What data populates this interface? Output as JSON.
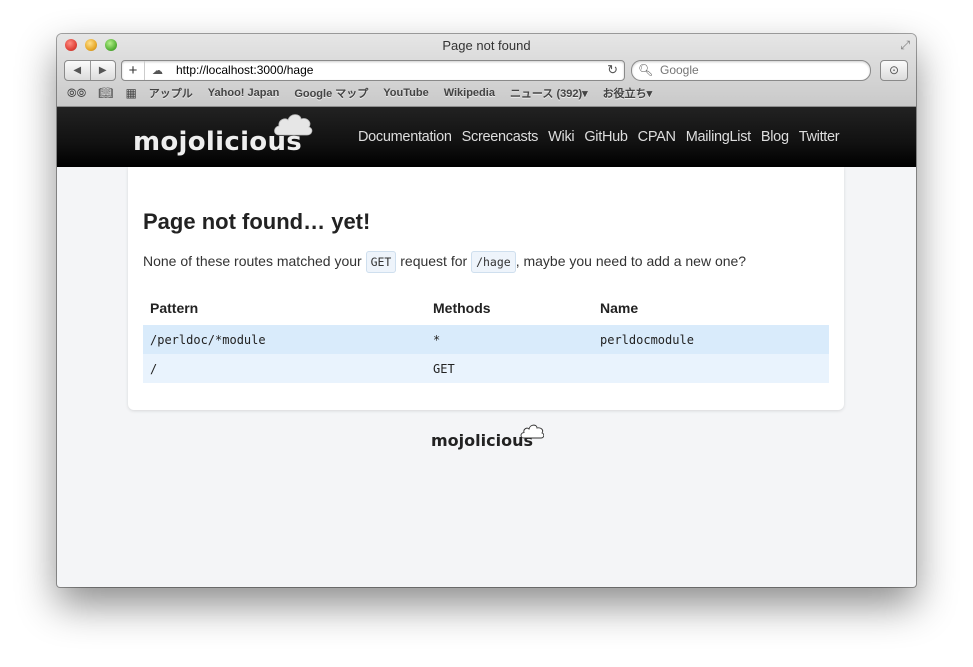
{
  "window": {
    "title": "Page not found",
    "url": "http://localhost:3000/hage",
    "search_placeholder": "Google",
    "new_tab_label": "+",
    "reload_label": "↻",
    "back_label": "◀",
    "forward_label": "▶",
    "download_label": "⊙"
  },
  "bookmarks": {
    "items": [
      "アップル",
      "Yahoo! Japan",
      "Google マップ",
      "YouTube",
      "Wikipedia",
      "ニュース (392)▾",
      "お役立ち▾"
    ]
  },
  "site": {
    "logo": "mojolicious",
    "nav": [
      "Documentation",
      "Screencasts",
      "Wiki",
      "GitHub",
      "CPAN",
      "MailingList",
      "Blog",
      "Twitter"
    ]
  },
  "main": {
    "heading": "Page not found… yet!",
    "msg_prefix": "None of these routes matched your",
    "method": "GET",
    "msg_middle": "request for",
    "path": "/hage",
    "msg_suffix": ", maybe you need to add a new one?",
    "table": {
      "headers": [
        "Pattern",
        "Methods",
        "Name"
      ],
      "rows": [
        [
          "/perldoc/*module",
          "*",
          "perldocmodule"
        ],
        [
          "/",
          "GET",
          ""
        ]
      ]
    }
  },
  "footer": {
    "logo": "mojolicious"
  }
}
